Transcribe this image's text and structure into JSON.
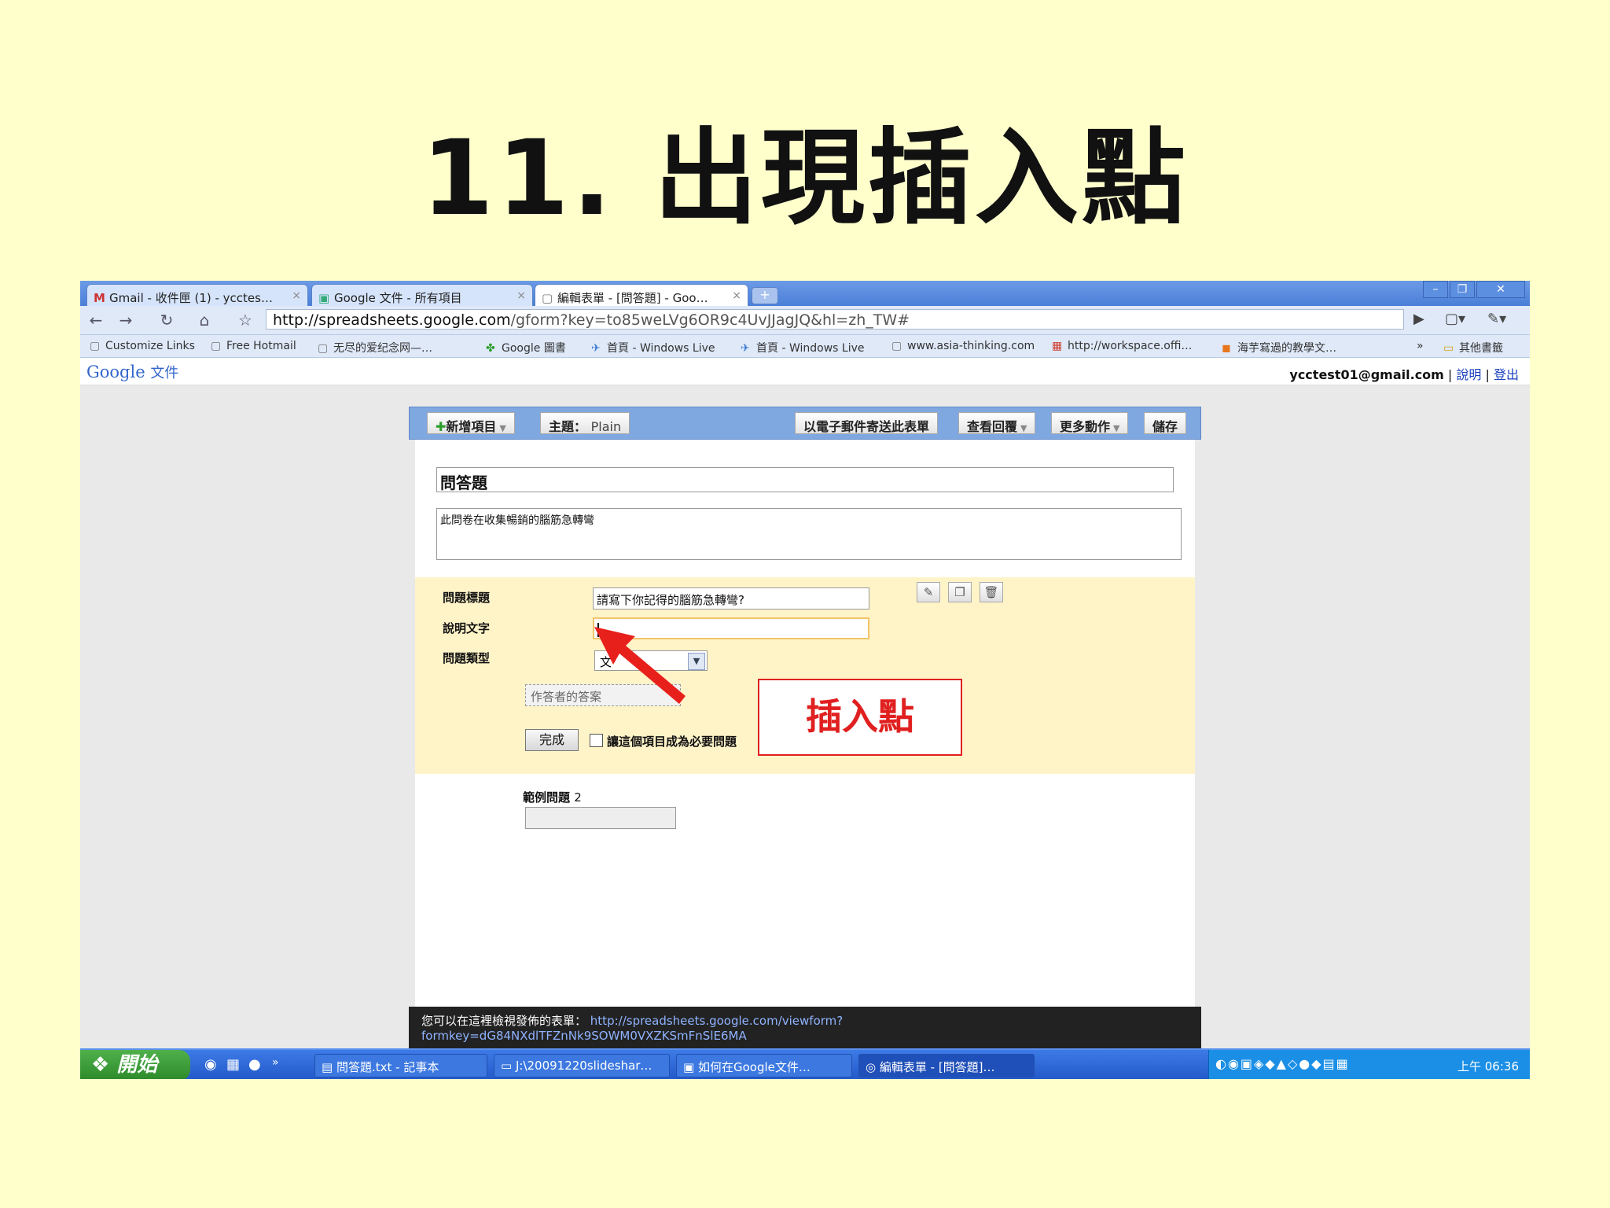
{
  "slide_title": "11. 出現插入點",
  "browser": {
    "tabs": [
      {
        "label": "Gmail - 收件匣 (1) - ycctes…",
        "icon": "gmail-icon"
      },
      {
        "label": "Google 文件 - 所有項目",
        "icon": "docs-icon"
      },
      {
        "label": "編輯表單 - [問答題] - Goo…",
        "icon": "page-icon"
      }
    ],
    "url_domain": "http://spreadsheets.google.com",
    "url_rest": "/gform?key=to85weLVg6OR9c4UvJJagJQ&hl=zh_TW#",
    "bookmarks": [
      "Customize Links",
      "Free Hotmail",
      "无尽的爱纪念网—…",
      "Google 圖書",
      "首頁 - Windows Live",
      "首頁 - Windows Live",
      "www.asia-thinking.com",
      "http://workspace.offi…",
      "海芋寫過的教學文…"
    ],
    "other_bookmarks": "其他書籤"
  },
  "gbar": {
    "logo": "Google",
    "product": "文件",
    "email": "ycctest01@gmail.com",
    "help": "說明",
    "logout": "登出"
  },
  "form_toolbar": {
    "add_item": "新增項目",
    "theme_label": "主題：",
    "theme_value": "Plain",
    "email_form": "以電子郵件寄送此表單",
    "view_responses": "查看回覆",
    "more_actions": "更多動作",
    "save": "儲存"
  },
  "form": {
    "title": "問答題",
    "description": "此問卷在收集暢銷的腦筋急轉彎",
    "question_title_label": "問題標題",
    "question_title_value": "請寫下你記得的腦筋急轉彎?",
    "help_text_label": "說明文字",
    "help_text_value": "",
    "question_type_label": "問題類型",
    "question_type_value": "文",
    "answer_placeholder": "作答者的答案",
    "done_button": "完成",
    "required_label": "讓這個項目成為必要問題",
    "sample_question": "範例問題",
    "sample_number": "2",
    "publish_text": "您可以在這裡檢視發佈的表單：",
    "publish_url_1": "http://spreadsheets.google.com/viewform?",
    "publish_url_2": "formkey=dG84NXdlTFZnNk9SOWM0VXZKSmFnSlE6MA"
  },
  "callout": "插入點",
  "taskbar": {
    "start": "開始",
    "tasks": [
      "問答題.txt - 記事本",
      "J:\\20091220slideshar…",
      "如何在Google文件…",
      "編輯表單 - [問答題]…"
    ],
    "clock": "上午 06:36"
  },
  "colors": {
    "slide_bg": "#ffffcc",
    "callout_red": "#e02020",
    "question_panel": "#fff3c8",
    "toolbar_blue": "#7fa7e0"
  }
}
